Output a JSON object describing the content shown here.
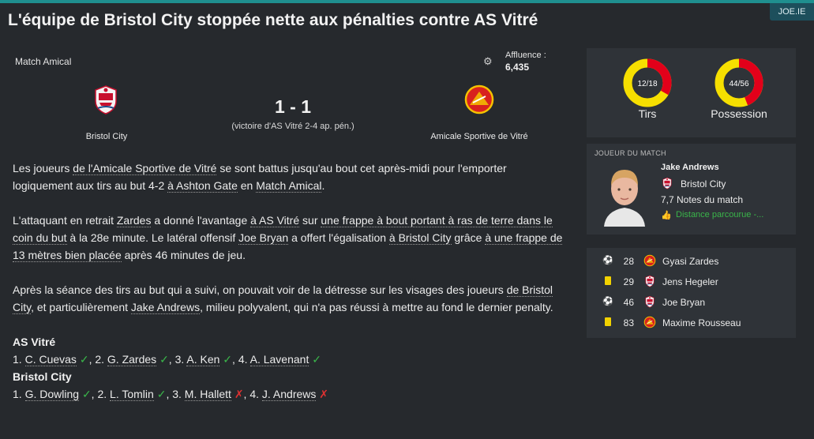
{
  "header": {
    "title": "L'équipe de Bristol City stoppée nette aux pénalties contre AS Vitré",
    "badge": "JOE.IE"
  },
  "match": {
    "competition": "Match Amical",
    "attendance_label": "Affluence :",
    "attendance_value": "6,435",
    "home_team": "Bristol City",
    "away_team": "Amicale Sportive de Vitré",
    "score": "1 - 1",
    "penalty_note": "(victoire d'AS Vitré 2-4 ap. pén.)"
  },
  "article": {
    "p1": {
      "t1": "Les joueurs ",
      "l1": "de l'Amicale Sportive de Vitré",
      "t2": " se sont battus jusqu'au bout cet après-midi pour l'emporter logiquement aux tirs au but 4-2 ",
      "l2": "à Ashton Gate",
      "t3": " en ",
      "l3": "Match Amical",
      "t4": "."
    },
    "p2": {
      "t1": "L'attaquant en retrait ",
      "l1": "Zardes",
      "t2": " a donné l'avantage ",
      "l2": "à AS Vitré",
      "t3": " sur ",
      "l3": "une frappe à bout portant à ras de terre dans le coin du but",
      "t4": " à la 28e minute. Le latéral offensif ",
      "l4": "Joe Bryan",
      "t5": " a offert l'égalisation ",
      "l5": "à Bristol City",
      "t6": " grâce ",
      "l6": "à une frappe de 13 mètres bien placée",
      "t7": " après 46 minutes de jeu."
    },
    "p3": {
      "t1": "Après la séance des tirs au but qui a suivi, on pouvait voir de la détresse sur les visages des joueurs ",
      "l1": "de Bristol City",
      "t2": ", et particulièrement ",
      "l2": "Jake Andrews",
      "t3": ", milieu polyvalent, qui n'a pas réussi à mettre au fond le dernier penalty."
    },
    "shootout": [
      {
        "team": "AS Vitré",
        "kicks": [
          {
            "n": "1. ",
            "name": "C. Cuevas",
            "result": "✓",
            "scored": true
          },
          {
            "n": "2. ",
            "name": "G. Zardes",
            "result": "✓",
            "scored": true
          },
          {
            "n": "3. ",
            "name": "A. Ken",
            "result": "✓",
            "scored": true
          },
          {
            "n": "4. ",
            "name": "A. Lavenant",
            "result": "✓",
            "scored": true
          }
        ]
      },
      {
        "team": "Bristol City",
        "kicks": [
          {
            "n": "1. ",
            "name": "G. Dowling",
            "result": "✓",
            "scored": true
          },
          {
            "n": "2. ",
            "name": "L. Tomlin",
            "result": "✓",
            "scored": true
          },
          {
            "n": "3. ",
            "name": "M. Hallett",
            "result": "✗",
            "scored": false
          },
          {
            "n": "4. ",
            "name": "J. Andrews",
            "result": "✗",
            "scored": false
          }
        ]
      }
    ]
  },
  "stats": {
    "shots": {
      "text": "12/18",
      "label": "Tirs",
      "fraction": 0.333
    },
    "possession": {
      "text": "44/56",
      "label": "Possession",
      "fraction": 0.44
    },
    "colors": {
      "home": "#e2001a",
      "away": "#f6df00"
    }
  },
  "motm": {
    "header": "JOUEUR DU MATCH",
    "name": "Jake Andrews",
    "club": "Bristol City",
    "rating": "7,7 Notes du match",
    "distance": "Distance parcourue -..."
  },
  "events": [
    {
      "type": "goal",
      "icon": "ball-icon",
      "minute": "28",
      "team": "asv",
      "player": "Gyasi Zardes"
    },
    {
      "type": "card",
      "icon": "yellow-card-icon",
      "minute": "29",
      "team": "bc",
      "player": "Jens Hegeler"
    },
    {
      "type": "goal",
      "icon": "ball-icon",
      "minute": "46",
      "team": "bc",
      "player": "Joe Bryan"
    },
    {
      "type": "card",
      "icon": "yellow-card-icon",
      "minute": "83",
      "team": "asv",
      "player": "Maxime Rousseau"
    }
  ]
}
